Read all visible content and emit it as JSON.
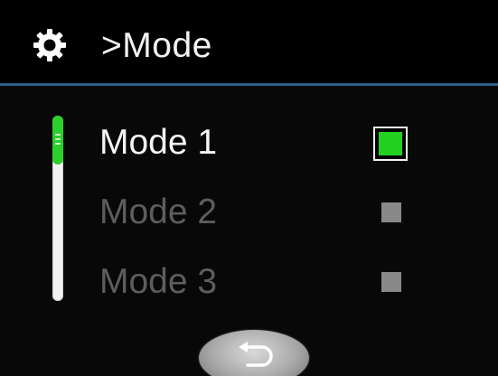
{
  "header": {
    "title": ">Mode",
    "icon": "gear-icon"
  },
  "modes": [
    {
      "label": "Mode 1",
      "selected": true
    },
    {
      "label": "Mode 2",
      "selected": false
    },
    {
      "label": "Mode 3",
      "selected": false
    }
  ],
  "back_button": {
    "icon": "back-arrow-icon"
  },
  "colors": {
    "background": "#080808",
    "header_divider": "#2d5f86",
    "selected_green": "#22d022",
    "inactive_text": "#5d5d5d",
    "active_text": "#f5f5f5"
  }
}
